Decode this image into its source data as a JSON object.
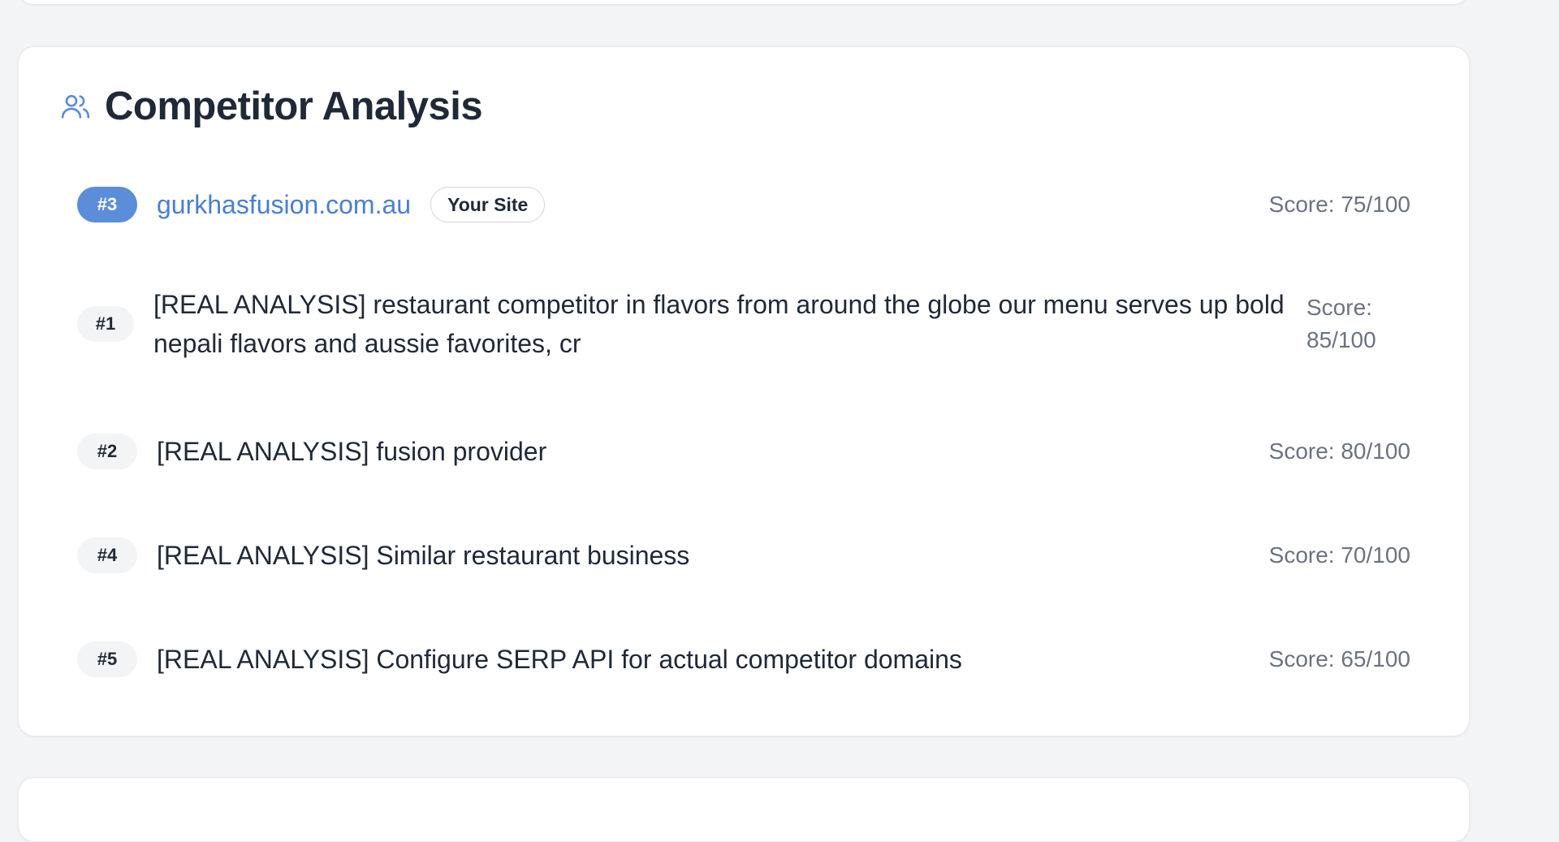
{
  "section": {
    "title": "Competitor Analysis",
    "icon": "users-icon",
    "accent": "#5b8dd9"
  },
  "own_site": {
    "rank": "#3",
    "domain": "gurkhasfusion.com.au",
    "badge": "Your Site",
    "score": "Score: 75/100"
  },
  "competitors": [
    {
      "rank": "#1",
      "name": "[REAL ANALYSIS] restaurant competitor in flavors from around the globe our menu serves up bold nepali flavors and aussie favorites, cr",
      "score": "Score: 85/100"
    },
    {
      "rank": "#2",
      "name": "[REAL ANALYSIS] fusion provider",
      "score": "Score: 80/100"
    },
    {
      "rank": "#4",
      "name": "[REAL ANALYSIS] Similar restaurant business",
      "score": "Score: 70/100"
    },
    {
      "rank": "#5",
      "name": "[REAL ANALYSIS] Configure SERP API for actual competitor domains",
      "score": "Score: 65/100"
    }
  ]
}
